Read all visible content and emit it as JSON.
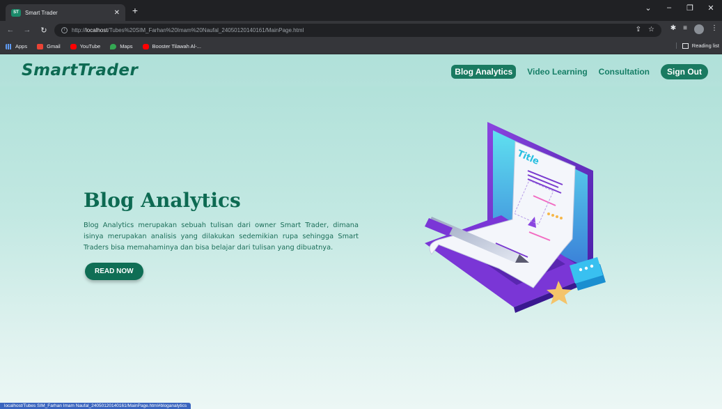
{
  "browser": {
    "tab_title": "Smart Trader",
    "tab_favicon": "ST",
    "new_tab": "+",
    "url_prefix": "http://",
    "url_host": "localhost",
    "url_path": "/Tubes%20SIM_Farhan%20Imam%20Naufal_24050120140161/MainPage.html",
    "bookmarks": [
      "Apps",
      "Gmail",
      "YouTube",
      "Maps",
      "Booster Tilawah Al-..."
    ],
    "reading_list": "Reading list"
  },
  "nav": {
    "brand": "SmartTrader",
    "links": [
      "Blog Analytics",
      "Video Learning",
      "Consultation"
    ],
    "signout": "Sign Out"
  },
  "hero": {
    "title": "Blog Analytics",
    "text": "Blog Analytics merupakan sebuah tulisan dari owner Smart Trader, dimana isinya merupakan analisis yang dilakukan sedemikian rupa sehingga Smart Traders bisa memahaminya dan bisa belajar dari tulisan yang dibuatnya.",
    "cta": "READ NOW",
    "illustration_title": "Title"
  },
  "status_url": "localhost/Tubes SIM_Farhan Imam Naufal_24050120140161/MainPage.html#bloganalytics",
  "colors": {
    "brand": "#0d6a52",
    "accent": "#1a7a61",
    "status": "#3a65bf"
  }
}
